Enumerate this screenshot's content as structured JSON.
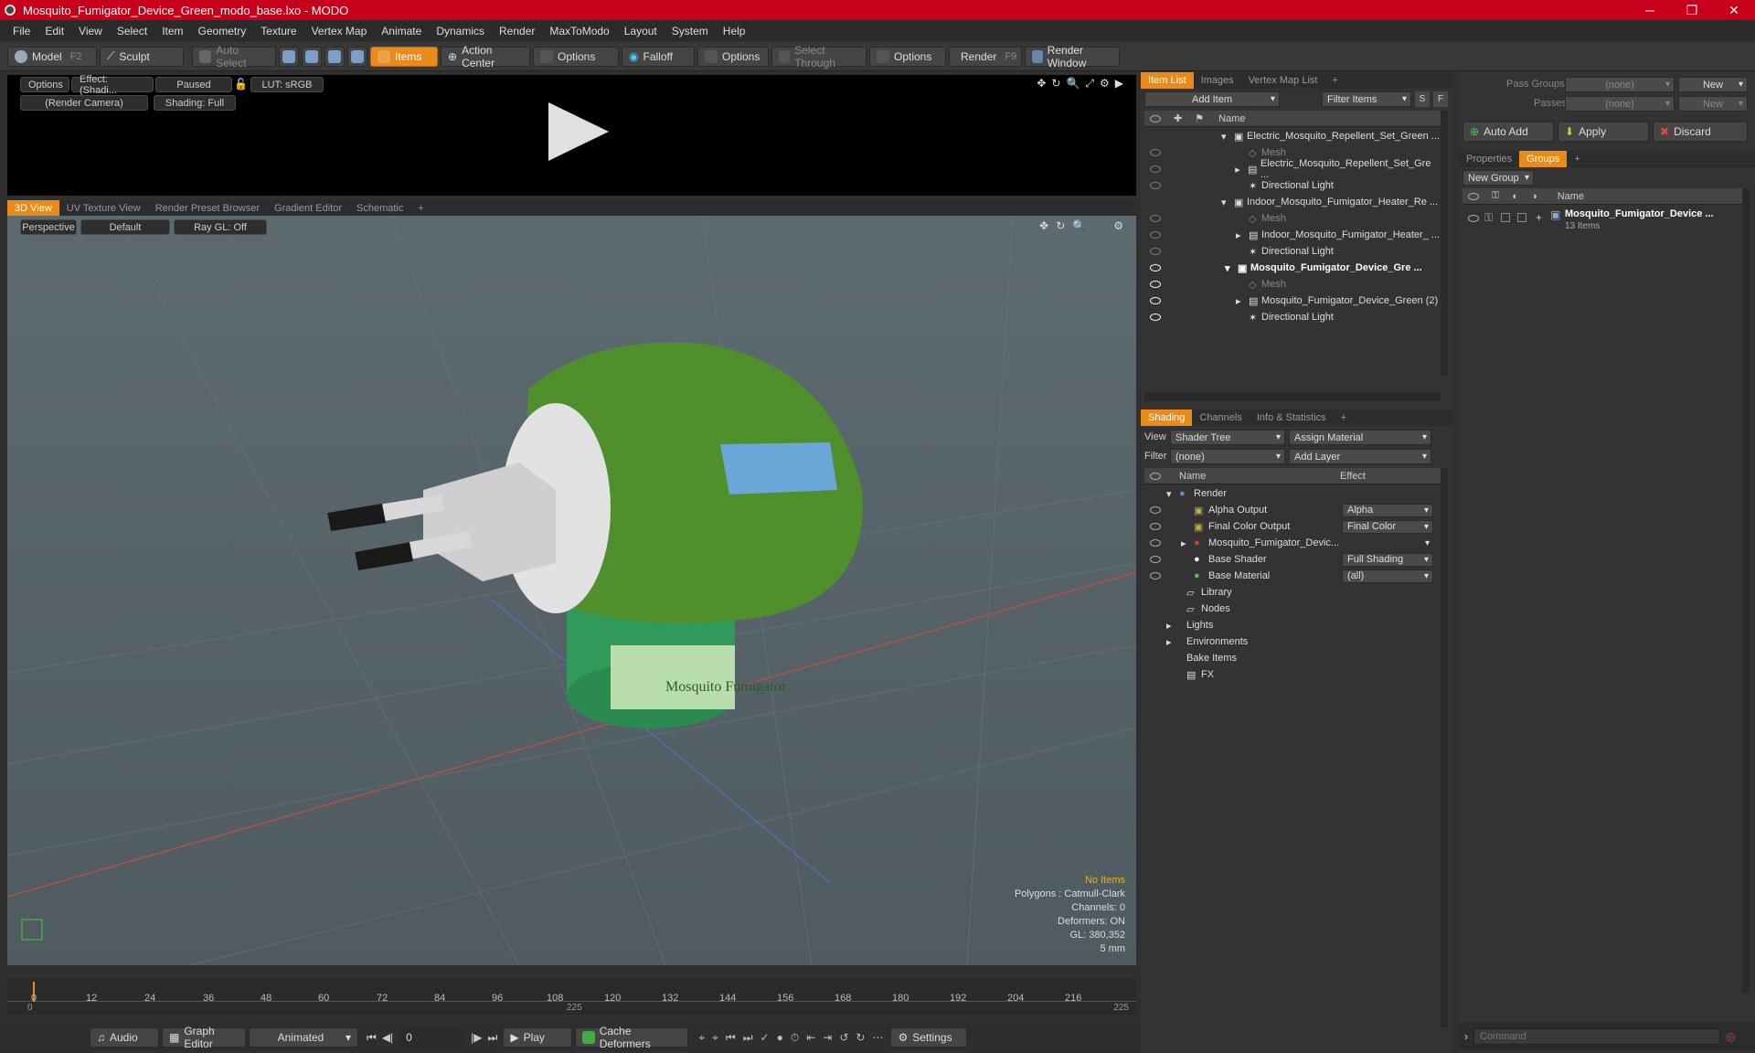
{
  "window": {
    "title": "Mosquito_Fumigator_Device_Green_modo_base.lxo - MODO"
  },
  "menu": [
    "File",
    "Edit",
    "View",
    "Select",
    "Item",
    "Geometry",
    "Texture",
    "Vertex Map",
    "Animate",
    "Dynamics",
    "Render",
    "MaxToModo",
    "Layout",
    "System",
    "Help"
  ],
  "toolbar": {
    "model": "Model",
    "model_key": "F2",
    "sculpt": "Sculpt",
    "auto_select": "Auto Select",
    "items": "Items",
    "action_center": "Action Center",
    "options1": "Options",
    "falloff": "Falloff",
    "options2": "Options",
    "select_through": "Select Through",
    "options3": "Options",
    "render": "Render",
    "render_key": "F9",
    "render_window": "Render Window"
  },
  "preview": {
    "options": "Options",
    "effect": "Effect: (Shadi...",
    "paused": "Paused",
    "lut": "LUT: sRGB",
    "camera": "(Render Camera)",
    "shading": "Shading: Full"
  },
  "view_tabs": [
    "3D View",
    "UV Texture View",
    "Render Preset Browser",
    "Gradient Editor",
    "Schematic"
  ],
  "viewport": {
    "perspective": "Perspective",
    "default": "Default",
    "raygl": "Ray GL: Off",
    "label_text": "Mosquito Fumigator",
    "info": {
      "no_items": "No Items",
      "polygons": "Polygons : Catmull-Clark",
      "channels": "Channels: 0",
      "deformers": "Deformers: ON",
      "gl": "GL: 380,352",
      "unit": "5 mm"
    }
  },
  "timeline": {
    "ticks": [
      "0",
      "12",
      "24",
      "36",
      "48",
      "60",
      "72",
      "84",
      "96",
      "108",
      "120",
      "132",
      "144",
      "156",
      "168",
      "180",
      "192",
      "204",
      "216"
    ],
    "start": "0",
    "mid": "225",
    "end": "225"
  },
  "bottom": {
    "audio": "Audio",
    "graph_editor": "Graph Editor",
    "animated": "Animated",
    "frame": "0",
    "play": "Play",
    "cache_deformers": "Cache Deformers",
    "settings": "Settings"
  },
  "item_list": {
    "tabs": [
      "Item List",
      "Images",
      "Vertex Map List"
    ],
    "add_item": "Add Item",
    "filter_items": "Filter Items",
    "s": "S",
    "f": "F",
    "col_name": "Name",
    "rows": [
      {
        "label": "Electric_Mosquito_Repellent_Set_Green ...",
        "indent": 0,
        "bold": false,
        "dim": false
      },
      {
        "label": "Mesh",
        "indent": 1,
        "bold": false,
        "dim": true
      },
      {
        "label": "Electric_Mosquito_Repellent_Set_Gre ...",
        "indent": 1,
        "bold": false,
        "dim": false
      },
      {
        "label": "Directional Light",
        "indent": 1,
        "bold": false,
        "dim": false
      },
      {
        "label": "Indoor_Mosquito_Fumigator_Heater_Re ...",
        "indent": 0,
        "bold": false,
        "dim": false
      },
      {
        "label": "Mesh",
        "indent": 1,
        "bold": false,
        "dim": true
      },
      {
        "label": "Indoor_Mosquito_Fumigator_Heater_ ...",
        "indent": 1,
        "bold": false,
        "dim": false
      },
      {
        "label": "Directional Light",
        "indent": 1,
        "bold": false,
        "dim": false
      },
      {
        "label": "Mosquito_Fumigator_Device_Gre ...",
        "indent": 0,
        "bold": true,
        "dim": false
      },
      {
        "label": "Mesh",
        "indent": 1,
        "bold": false,
        "dim": true
      },
      {
        "label": "Mosquito_Fumigator_Device_Green (2)",
        "indent": 1,
        "bold": false,
        "dim": false
      },
      {
        "label": "Directional Light",
        "indent": 1,
        "bold": false,
        "dim": false
      }
    ]
  },
  "shading": {
    "tabs": [
      "Shading",
      "Channels",
      "Info & Statistics"
    ],
    "view_label": "View",
    "view_value": "Shader Tree",
    "assign_material": "Assign Material",
    "filter_label": "Filter",
    "filter_value": "(none)",
    "add_layer": "Add Layer",
    "col_name": "Name",
    "col_effect": "Effect",
    "rows": [
      {
        "name": "Render",
        "effect": "",
        "indent": 0
      },
      {
        "name": "Alpha Output",
        "effect": "Alpha",
        "indent": 1
      },
      {
        "name": "Final Color Output",
        "effect": "Final Color",
        "indent": 1
      },
      {
        "name": "Mosquito_Fumigator_Devic...",
        "effect": "",
        "indent": 1
      },
      {
        "name": "Base Shader",
        "effect": "Full Shading",
        "indent": 1
      },
      {
        "name": "Base Material",
        "effect": "(all)",
        "indent": 1
      },
      {
        "name": "Library",
        "effect": "",
        "indent": 0
      },
      {
        "name": "Nodes",
        "effect": "",
        "indent": 0
      },
      {
        "name": "Lights",
        "effect": "",
        "indent": 0
      },
      {
        "name": "Environments",
        "effect": "",
        "indent": 0
      },
      {
        "name": "Bake Items",
        "effect": "",
        "indent": 0
      },
      {
        "name": "FX",
        "effect": "",
        "indent": 0
      }
    ]
  },
  "groups": {
    "pass_groups": "Pass Groups",
    "pass_value": "(none)",
    "new": "New",
    "passes": "Passes",
    "passes_value": "(none)",
    "new2": "New",
    "auto_add": "Auto Add",
    "apply": "Apply",
    "discard": "Discard",
    "tabs": [
      "Properties",
      "Groups"
    ],
    "new_group": "New Group",
    "col_name": "Name",
    "item_name": "Mosquito_Fumigator_Device ...",
    "item_count": "13 Items"
  },
  "command": {
    "placeholder": "Command"
  }
}
